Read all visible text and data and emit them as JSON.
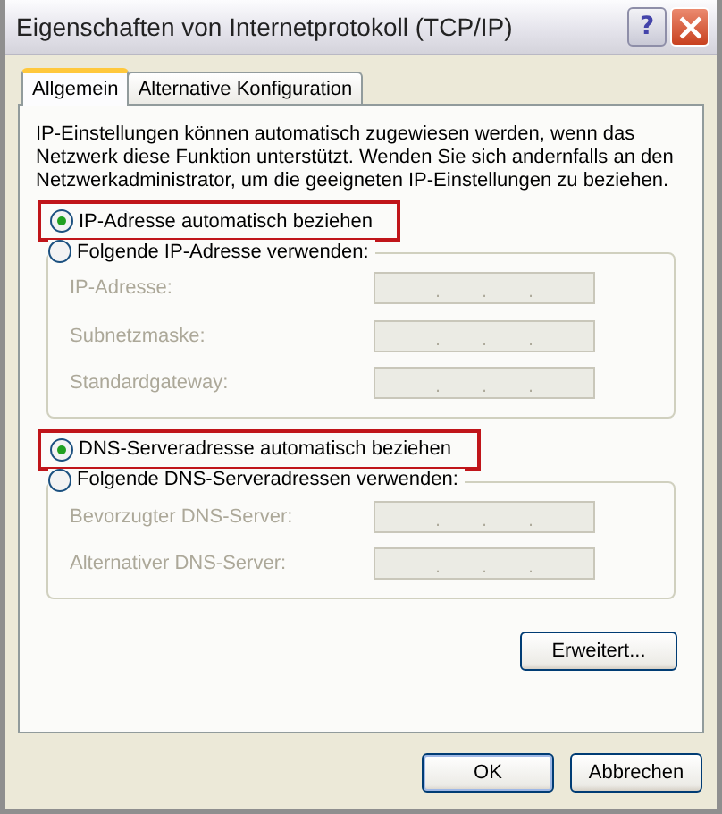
{
  "window": {
    "title": "Eigenschaften von Internetprotokoll (TCP/IP)",
    "controls": [
      {
        "kind": "help",
        "label": "?"
      },
      {
        "kind": "close"
      }
    ]
  },
  "tabs": [
    {
      "label": "Allgemein",
      "selected": true
    },
    {
      "label": "Alternative Konfiguration",
      "selected": false
    }
  ],
  "intro": "IP-Einstellungen können automatisch zugewiesen werden, wenn das Netzwerk diese Funktion unterstützt. Wenden Sie sich andernfalls an den Netzwerkadministrator, um die geeigneten IP-Einstellungen zu beziehen.",
  "sections": [
    {
      "auto": {
        "label": "IP-Adresse automatisch beziehen",
        "selected": true,
        "highlighted": true
      },
      "manual": {
        "label": "Folgende IP-Adresse verwenden:",
        "selected": false
      },
      "fields": [
        {
          "label": "IP-Adresse:",
          "disabled": true,
          "separators": [
            ".",
            ".",
            "."
          ]
        },
        {
          "label": "Subnetzmaske:",
          "disabled": true,
          "separators": [
            ".",
            ".",
            "."
          ]
        },
        {
          "label": "Standardgateway:",
          "disabled": true,
          "separators": [
            ".",
            ".",
            "."
          ]
        }
      ]
    },
    {
      "auto": {
        "label": "DNS-Serveradresse automatisch beziehen",
        "selected": true,
        "highlighted": true
      },
      "manual": {
        "label": "Folgende DNS-Serveradressen verwenden:",
        "selected": false
      },
      "fields": [
        {
          "label": "Bevorzugter DNS-Server:",
          "disabled": true,
          "separators": [
            ".",
            ".",
            "."
          ]
        },
        {
          "label": "Alternativer DNS-Server:",
          "disabled": true,
          "separators": [
            ".",
            ".",
            "."
          ]
        }
      ]
    }
  ],
  "advanced_button": "Erweitert...",
  "buttons": [
    "OK",
    "Abbrechen"
  ]
}
